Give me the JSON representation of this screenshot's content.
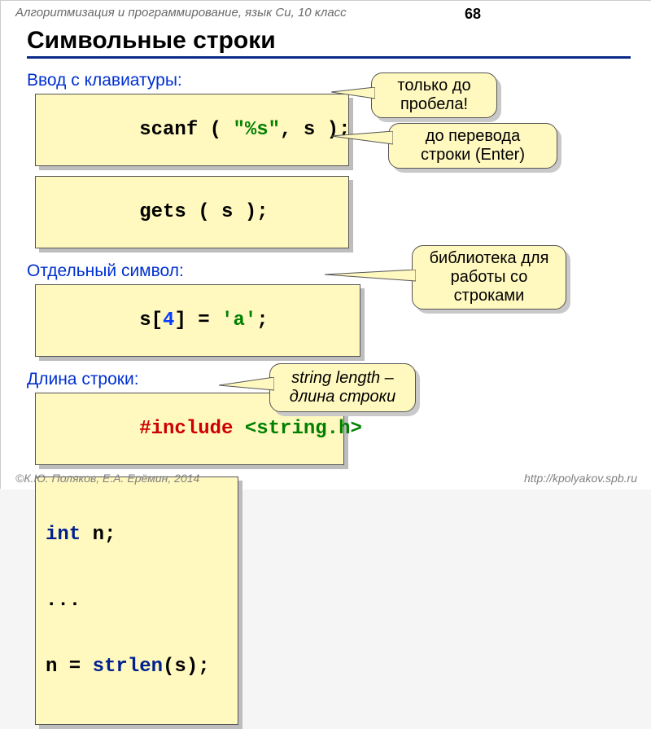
{
  "header": {
    "breadcrumb": "Алгоритмизация и программирование, язык Си, 10 класс",
    "page_number": "68",
    "title": "Символьные строки"
  },
  "sections": {
    "input": {
      "label": "Ввод с клавиатуры:"
    },
    "char": {
      "label": "Отдельный символ:"
    },
    "len": {
      "label": "Длина строки:"
    }
  },
  "code": {
    "scanf": {
      "t1": "scanf ( ",
      "t2": "\"%s\"",
      "t3": ", s );"
    },
    "gets": {
      "t1": "gets ( s );"
    },
    "index": {
      "t1": "s[",
      "t2": "4",
      "t3": "] = ",
      "t4": "'a'",
      "t5": ";"
    },
    "include": {
      "t1": "#include ",
      "t2": "<string.h>"
    },
    "strlen": {
      "l1a": "int",
      "l1b": " n;",
      "l2": "...",
      "l3a": "n = ",
      "l3b": "strlen",
      "l3c": "(s);"
    }
  },
  "callouts": {
    "scanf": "только до пробела!",
    "gets": "до перевода строки (Enter)",
    "include": "библиотека для работы со строками",
    "strlen": "string length – длина строки"
  },
  "footer": {
    "left": "©К.Ю. Поляков, Е.А. Ерёмин, 2014",
    "right": "http://kpolyakov.spb.ru"
  }
}
